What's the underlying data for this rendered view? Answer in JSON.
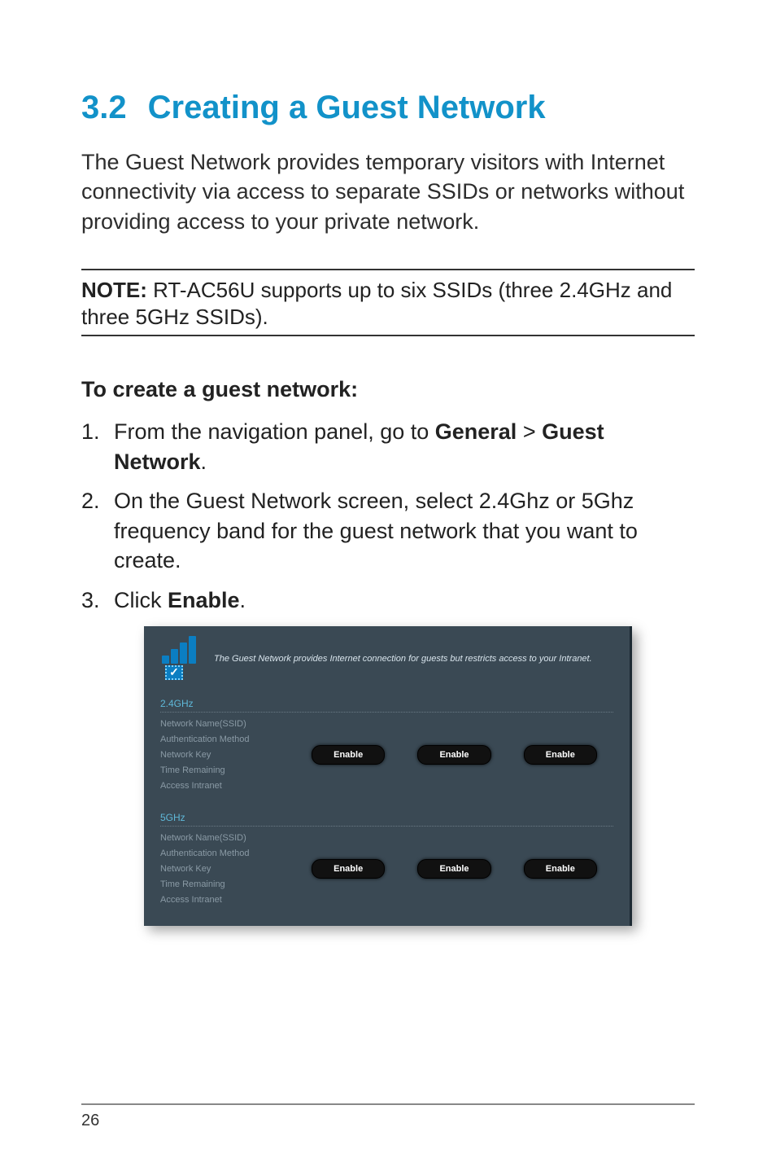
{
  "heading": {
    "number": "3.2",
    "title": "Creating a Guest Network"
  },
  "intro": "The Guest Network provides temporary visitors with Internet connectivity via access to separate SSIDs or networks without providing access to your private network.",
  "note": {
    "label": "NOTE:",
    "text": " RT-AC56U supports up to six SSIDs (three 2.4GHz and three 5GHz SSIDs)."
  },
  "subhead": "To create a guest network:",
  "steps": [
    {
      "n": "1.",
      "pre": "From the navigation panel, go to ",
      "b1": "General",
      "mid": " > ",
      "b2": "Guest Network",
      "post": "."
    },
    {
      "n": "2.",
      "text": "On the Guest Network screen, select 2.4Ghz or 5Ghz frequency band for the guest network that you want to create."
    },
    {
      "n": "3.",
      "pre": "Click ",
      "b1": "Enable",
      "post": "."
    }
  ],
  "screenshot": {
    "desc": "The Guest Network provides Internet connection for guests but restricts access to your Intranet.",
    "check": "✓",
    "labels": [
      "Network Name(SSID)",
      "Authentication Method",
      "Network Key",
      "Time Remaining",
      "Access Intranet"
    ],
    "bands": [
      {
        "title": "2.4GHz",
        "buttons": [
          "Enable",
          "Enable",
          "Enable"
        ]
      },
      {
        "title": "5GHz",
        "buttons": [
          "Enable",
          "Enable",
          "Enable"
        ]
      }
    ]
  },
  "page_number": "26"
}
